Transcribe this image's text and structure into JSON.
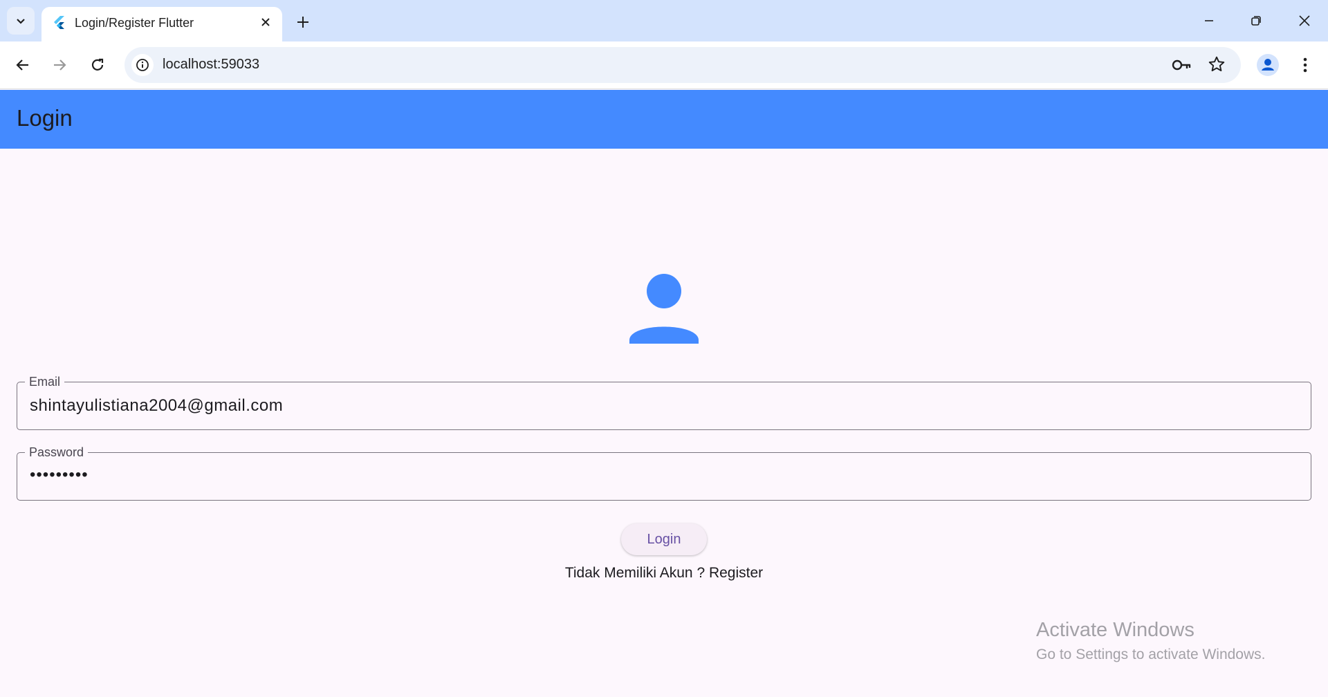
{
  "browser": {
    "tab_title": "Login/Register Flutter",
    "url": "localhost:59033"
  },
  "app": {
    "appbar_title": "Login",
    "email_label": "Email",
    "email_value": "shintayulistiana2004@gmail.com",
    "password_label": "Password",
    "password_value": "•••••••••",
    "login_button": "Login",
    "register_text": "Tidak Memiliki Akun ? Register"
  },
  "watermark": {
    "line1": "Activate Windows",
    "line2": "Go to Settings to activate Windows."
  },
  "colors": {
    "appbar": "#448aff",
    "icon": "#448aff",
    "button_text": "#6750a4"
  },
  "icons": [
    "chevron-down-icon",
    "flutter-icon",
    "close-icon",
    "plus-icon",
    "minimize-icon",
    "restore-icon",
    "window-close-icon",
    "back-icon",
    "forward-icon",
    "reload-icon",
    "info-icon",
    "key-icon",
    "star-icon",
    "profile-icon",
    "menu-icon",
    "person-icon"
  ]
}
